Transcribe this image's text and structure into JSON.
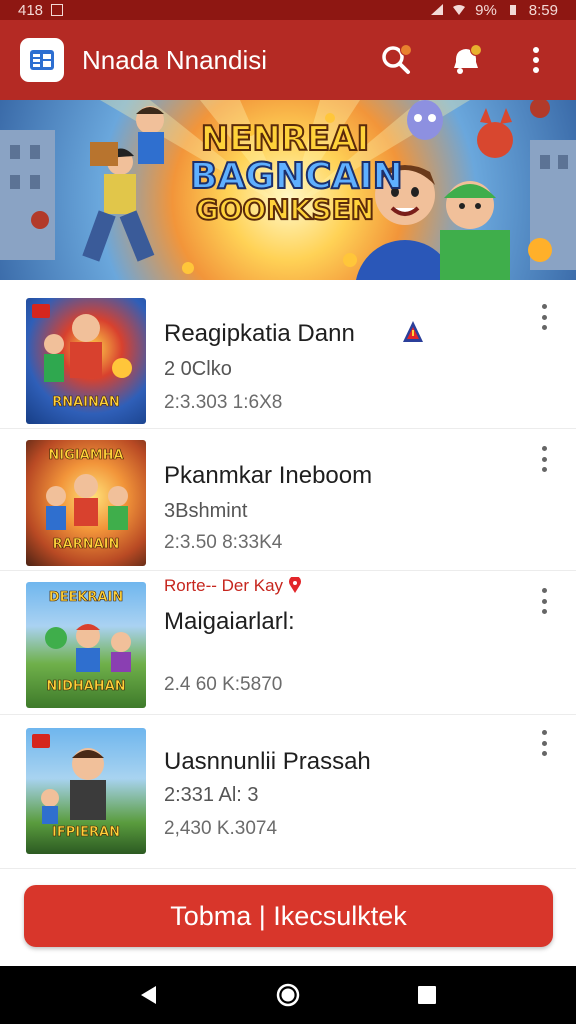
{
  "status_bar": {
    "left_text": "418",
    "battery": "9%",
    "time": "8:59"
  },
  "app_bar": {
    "title": "Nnada Nnandisi",
    "logo_icon": "app-logo-icon",
    "actions": [
      {
        "name": "search-icon"
      },
      {
        "name": "notification-bell-icon"
      },
      {
        "name": "more-vert-icon"
      }
    ]
  },
  "banner": {
    "line1": "NENREAI",
    "line2": "BAGNCAIN",
    "line3": "GOONKSEN"
  },
  "items": [
    {
      "tag": "",
      "title": "Reagipkatia Dann",
      "subtitle": "2 0Clko",
      "meta": "2:3.303 1:6X8",
      "thumb_top": "",
      "thumb_bottom": "RNAINAN"
    },
    {
      "tag": "",
      "title": "Pkanmkar Ineboom",
      "subtitle": "3Bshmint",
      "meta": "2:3.50 8:33K4",
      "thumb_top": "NIGIAMHA",
      "thumb_bottom": "RARNAIN"
    },
    {
      "tag": "Rorte-- Der Kay",
      "title": "Maigaiarlarl:",
      "subtitle": "",
      "meta": "2.4 60 K:5870",
      "thumb_top": "DEEKRAIN",
      "thumb_bottom": "NIDHAHAN"
    },
    {
      "tag": "",
      "title": "Uasnnunlii Prassah",
      "subtitle": "2:331 Al: 3",
      "meta": "2,430 K.3074",
      "thumb_top": "",
      "thumb_bottom": "IFPIERAN"
    }
  ],
  "cta": {
    "label": "Tobma | Ikecsulktek"
  },
  "colors": {
    "app_bar": "#b42a24",
    "status_bar": "#8e1712",
    "cta": "#d8362b",
    "accent_red": "#c6261e"
  },
  "nav": [
    "back-icon",
    "home-icon",
    "recents-icon"
  ]
}
